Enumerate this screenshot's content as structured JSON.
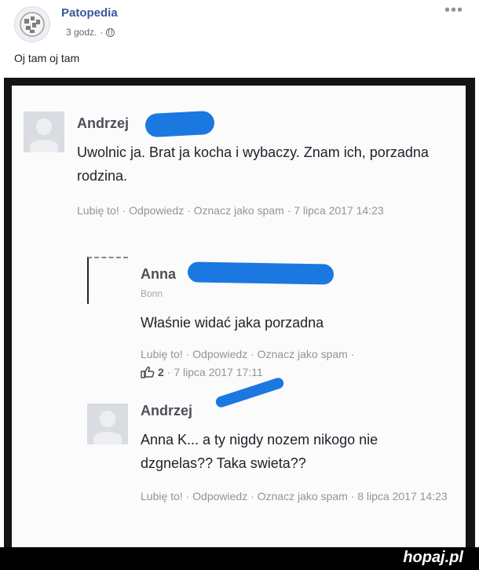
{
  "post": {
    "page_name": "Patopedia",
    "time": "3 godz.",
    "separator": "·",
    "more": "•••",
    "text": "Oj tam oj tam"
  },
  "comments": [
    {
      "author": "Andrzej",
      "text": "Uwolnic ja. Brat ja kocha i wybaczy. Znam ich, porzadna rodzina.",
      "actions": "Lubię to! · Odpowiedz · Oznacz jako spam · 7 lipca 2017 14:23"
    },
    {
      "author": "Anna",
      "location": "Bonn",
      "text": "Właśnie widać jaka porzadna",
      "actions": "Lubię to! · Odpowiedz · Oznacz jako spam ·",
      "likes": "2",
      "date": "· 7 lipca 2017 17:11"
    },
    {
      "author": "Andrzej",
      "text": "Anna K... a ty nigdy nozem nikogo nie dzgnelas?? Taka swieta??",
      "actions": "Lubię to! · Odpowiedz · Oznacz jako spam · 8 lipca 2017 14:23"
    }
  ],
  "watermark": "hopaj.pl",
  "colors": {
    "link": "#385898",
    "scribble": "#1b78e0"
  }
}
